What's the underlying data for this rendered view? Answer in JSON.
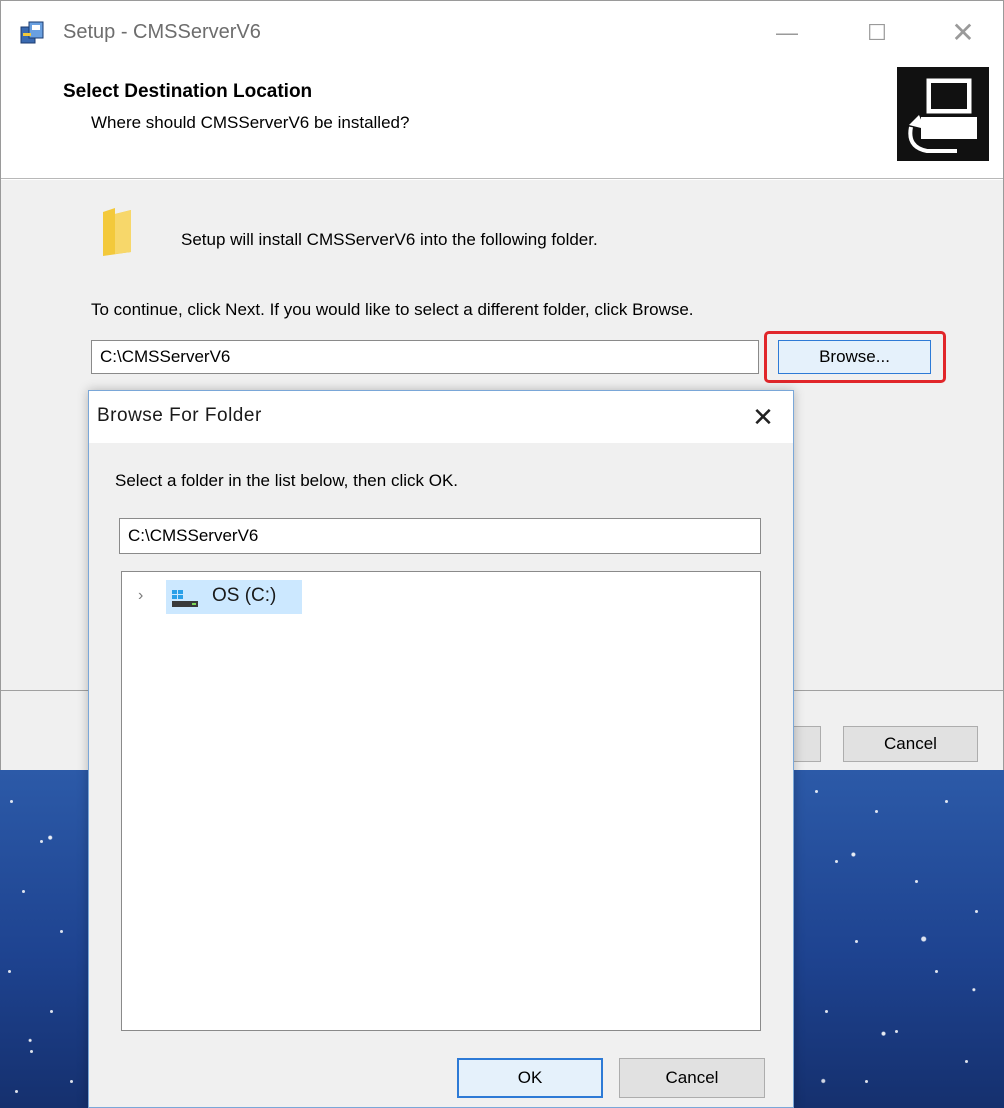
{
  "setup_window": {
    "title": "Setup - CMSServerV6",
    "controls": {
      "minimize": "—",
      "maximize": "☐",
      "close": "✕"
    },
    "header": {
      "title": "Select Destination Location",
      "subtitle": "Where should CMSServerV6 be installed?"
    },
    "body": {
      "info": "Setup will install CMSServerV6 into the following folder.",
      "instruction": "To continue, click Next. If you would like to select a different folder, click Browse.",
      "path_value": "C:\\CMSServerV6",
      "browse_label": "Browse..."
    },
    "footer": {
      "cancel_label": "Cancel"
    }
  },
  "browse_dialog": {
    "title": "Browse For Folder",
    "close": "✕",
    "instruction": "Select a folder in the list below, then click OK.",
    "path_value": "C:\\CMSServerV6",
    "tree": [
      {
        "expander": "›",
        "icon": "drive-icon",
        "label": "OS (C:)",
        "selected": true
      }
    ],
    "ok_label": "OK",
    "cancel_label": "Cancel"
  },
  "colors": {
    "highlight": "#e1262a",
    "accent_border": "#2d7ad6",
    "selection": "#cce8ff",
    "background_sky": "#1e4390"
  }
}
